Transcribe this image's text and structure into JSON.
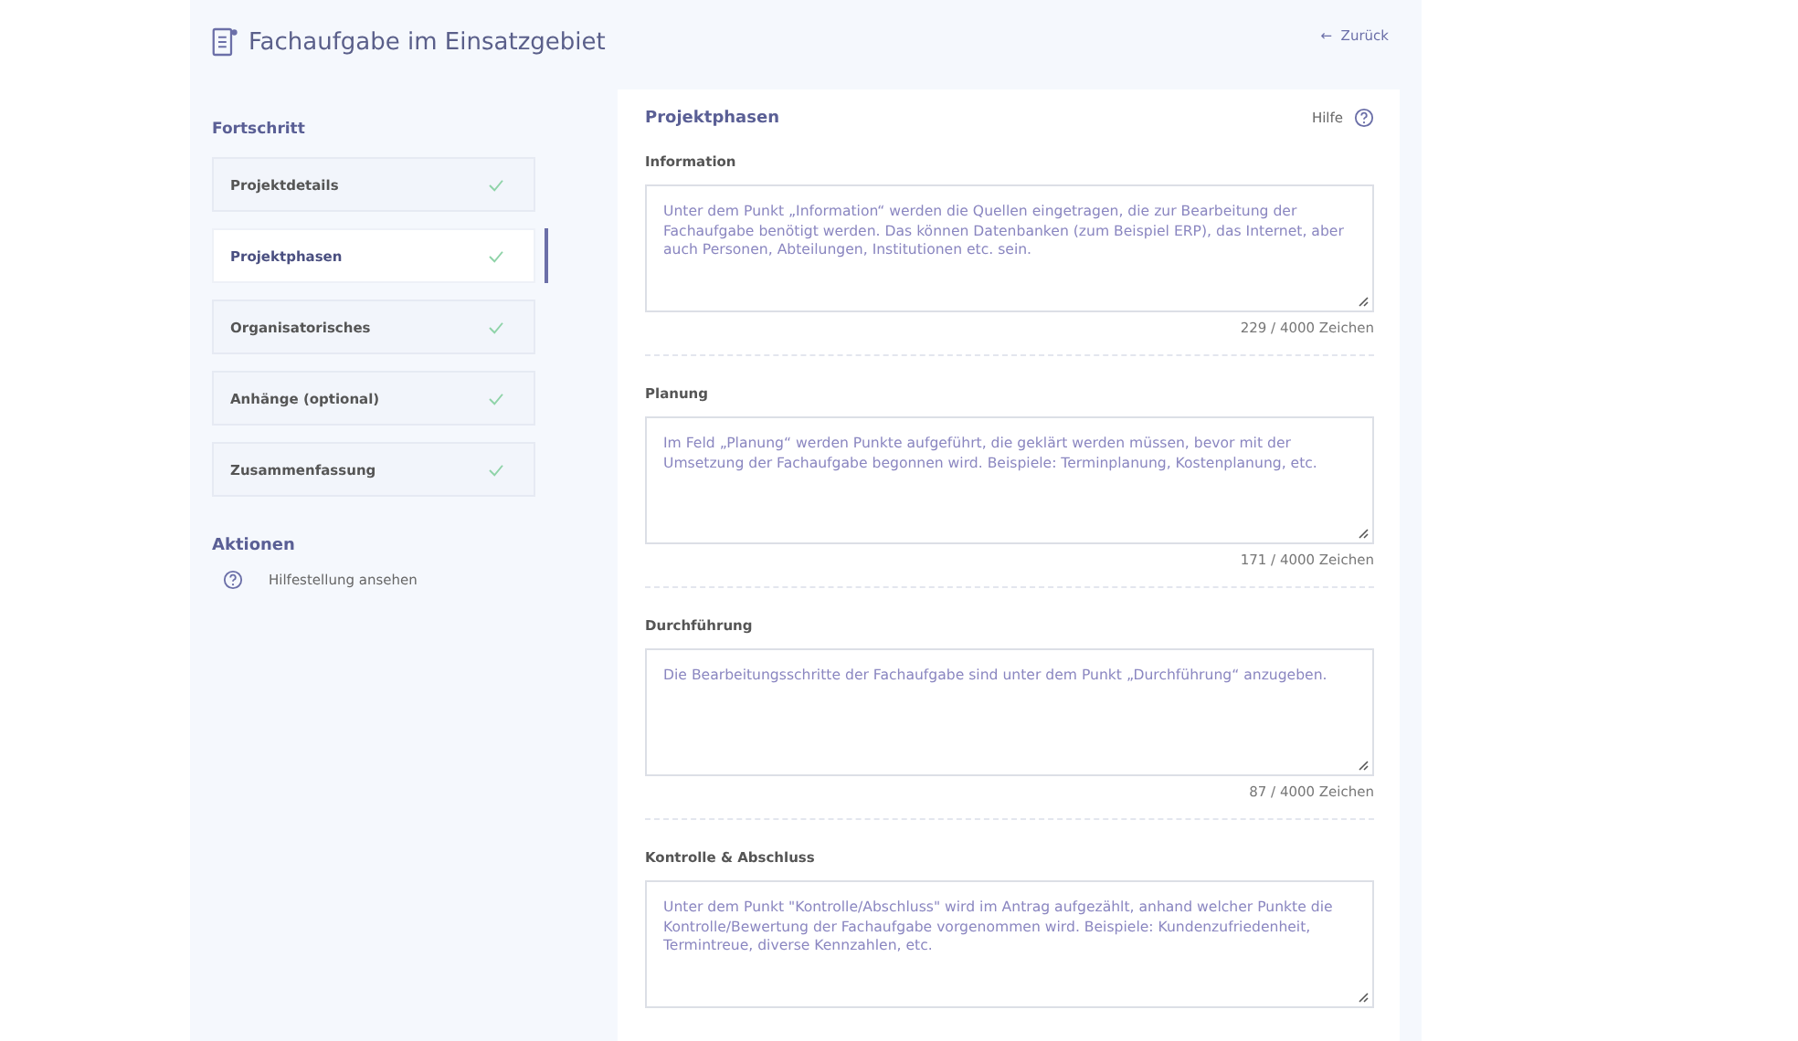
{
  "header": {
    "title": "Fachaufgabe im Einsatzgebiet",
    "back": "Zurück",
    "back_arrow": "←"
  },
  "sidebar": {
    "progress_title": "Fortschritt",
    "steps": [
      {
        "label": "Projektdetails",
        "selected": false,
        "done": true
      },
      {
        "label": "Projektphasen",
        "selected": true,
        "done": true
      },
      {
        "label": "Organisatorisches",
        "selected": false,
        "done": true
      },
      {
        "label": "Anhänge (optional)",
        "selected": false,
        "done": true
      },
      {
        "label": "Zusammenfassung",
        "selected": false,
        "done": true
      }
    ],
    "actions_title": "Aktionen",
    "actions": [
      {
        "label": "Hilfestellung ansehen"
      }
    ]
  },
  "main": {
    "title": "Projektphasen",
    "help": "Hilfe",
    "sections": [
      {
        "label": "Information",
        "value": "Unter dem Punkt „Information“ werden die Quellen eingetragen, die zur Bearbeitung der Fachaufgabe benötigt werden. Das können Datenbanken (zum Beispiel ERP), das Internet, aber auch Personen, Abteilungen, Institutionen etc. sein.",
        "counter": "229 / 4000 Zeichen"
      },
      {
        "label": "Planung",
        "value": "Im Feld „Planung“ werden Punkte aufgeführt, die geklärt werden müssen, bevor mit der Umsetzung der Fachaufgabe begonnen wird. Beispiele: Terminplanung, Kostenplanung, etc.",
        "counter": "171 / 4000 Zeichen"
      },
      {
        "label": "Durchführung",
        "value": "Die Bearbeitungsschritte der Fachaufgabe sind unter dem Punkt „Durchführung“ anzugeben.",
        "counter": "87 / 4000 Zeichen"
      },
      {
        "label": "Kontrolle & Abschluss",
        "value": "Unter dem Punkt \"Kontrolle/Abschluss\" wird im Antrag aufgezählt, anhand welcher Punkte die Kontrolle/Bewertung der Fachaufgabe vorgenommen wird. Beispiele: Kundenzufriedenheit, Termintreue, diverse Kennzahlen, etc."
      }
    ]
  }
}
